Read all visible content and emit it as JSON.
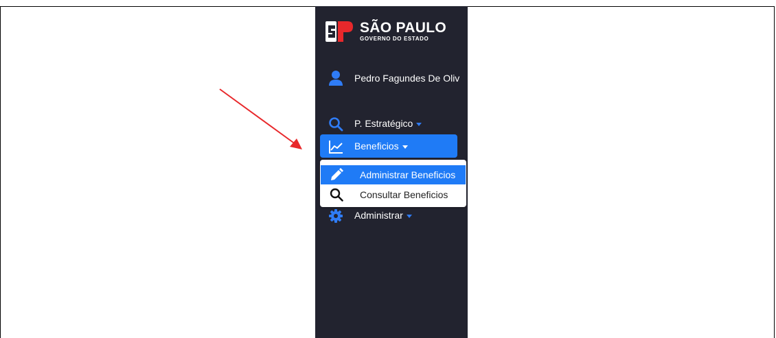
{
  "brand": {
    "title": "SÃO PAULO",
    "subtitle": "GOVERNO DO ESTADO",
    "colors": {
      "red": "#e8282b",
      "white": "#ffffff"
    }
  },
  "user": {
    "name": "Pedro Fagundes De Oliv",
    "icon": "user-icon"
  },
  "nav": {
    "items": [
      {
        "label": "P. Estratégico",
        "icon": "search-icon"
      },
      {
        "label": "Beneficios",
        "icon": "chart-line-icon",
        "active": true
      },
      {
        "label": "Administrar",
        "icon": "gear-icon"
      }
    ]
  },
  "dropdown": {
    "items": [
      {
        "label": "Administrar Beneficios",
        "icon": "pencil-icon",
        "active": true
      },
      {
        "label": "Consultar Beneficios",
        "icon": "search-icon"
      }
    ]
  },
  "annotation": {
    "icon": "red-arrow-icon",
    "color": "#e8282b"
  },
  "colors": {
    "sidebar": "#22232f",
    "accent": "#1f7bf6"
  }
}
